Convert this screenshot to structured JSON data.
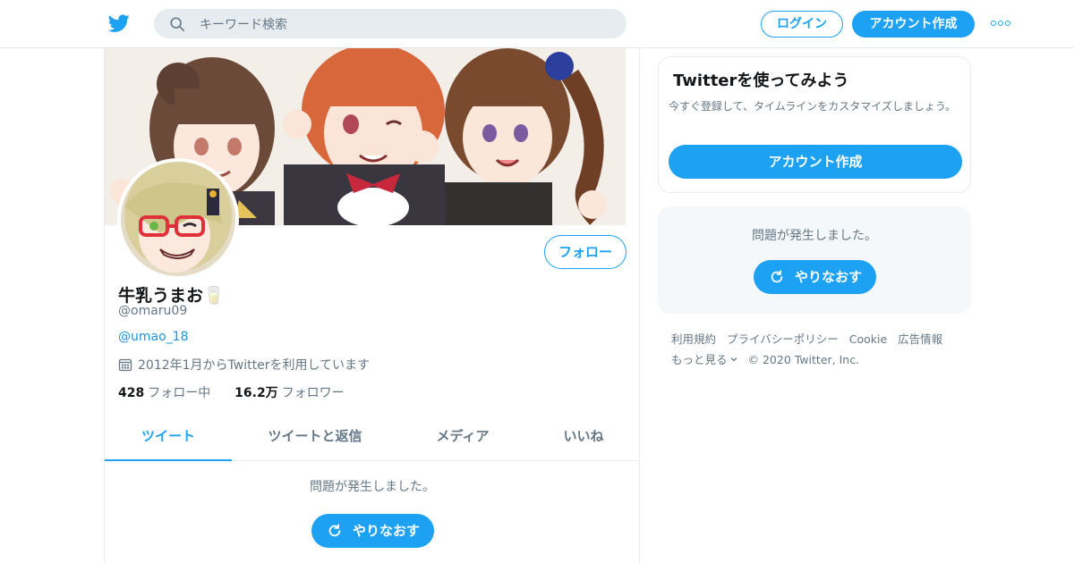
{
  "header": {
    "search_placeholder": "キーワード検索",
    "login_label": "ログイン",
    "signup_label": "アカウント作成",
    "logo_icon": "twitter-bird-icon",
    "more_icon": "more-dots-icon",
    "accent_color": "#1da1f2"
  },
  "profile": {
    "display_name": "牛乳うまお🥛",
    "handle": "@omaru09",
    "linked_account": "@umao_18",
    "joined": "2012年1月からTwitterを利用しています",
    "following_count": "428",
    "following_label": "フォロー中",
    "followers_count": "16.2万",
    "followers_label": "フォロワー",
    "follow_button": "フォロー"
  },
  "tabs": [
    {
      "label": "ツイート",
      "active": true
    },
    {
      "label": "ツイートと返信",
      "active": false
    },
    {
      "label": "メディア",
      "active": false
    },
    {
      "label": "いいね",
      "active": false
    }
  ],
  "timeline": {
    "error_message": "問題が発生しました。",
    "retry_label": "やりなおす"
  },
  "sidebar": {
    "promo_title": "Twitterを使ってみよう",
    "promo_description": "今すぐ登録して、タイムラインをカスタマイズしましょう。",
    "promo_button": "アカウント作成",
    "error_message": "問題が発生しました。",
    "retry_label": "やりなおす"
  },
  "footer": {
    "links": [
      "利用規約",
      "プライバシーポリシー",
      "Cookie",
      "広告情報"
    ],
    "more": "もっと見る",
    "copyright": "© 2020 Twitter, Inc."
  }
}
